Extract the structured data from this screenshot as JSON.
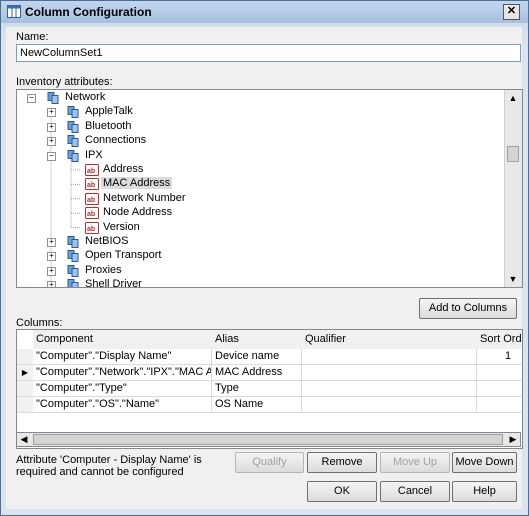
{
  "window": {
    "title": "Column Configuration",
    "close_glyph": "✕"
  },
  "name_field": {
    "label": "Name:",
    "value": "NewColumnSet1"
  },
  "inventory": {
    "label": "Inventory attributes:",
    "nodes": [
      {
        "label": "Network",
        "icon": "network-icon",
        "expander": "−",
        "level": 0
      },
      {
        "label": "AppleTalk",
        "icon": "network-icon",
        "expander": "+",
        "level": 1
      },
      {
        "label": "Bluetooth",
        "icon": "network-icon",
        "expander": "+",
        "level": 1
      },
      {
        "label": "Connections",
        "icon": "network-icon",
        "expander": "+",
        "level": 1
      },
      {
        "label": "IPX",
        "icon": "network-icon",
        "expander": "−",
        "level": 1
      },
      {
        "label": "Address",
        "icon": "attribute-icon",
        "level": 2
      },
      {
        "label": "MAC Address",
        "icon": "attribute-icon",
        "level": 2,
        "selected": true
      },
      {
        "label": "Network Number",
        "icon": "attribute-icon",
        "level": 2
      },
      {
        "label": "Node Address",
        "icon": "attribute-icon",
        "level": 2
      },
      {
        "label": "Version",
        "icon": "attribute-icon",
        "level": 2
      },
      {
        "label": "NetBIOS",
        "icon": "network-icon",
        "expander": "+",
        "level": 1
      },
      {
        "label": "Open Transport",
        "icon": "network-icon",
        "expander": "+",
        "level": 1
      },
      {
        "label": "Proxies",
        "icon": "network-icon",
        "expander": "+",
        "level": 1
      },
      {
        "label": "Shell Driver",
        "icon": "network-icon",
        "expander": "+",
        "level": 1
      }
    ],
    "add_button": "Add to Columns"
  },
  "columns": {
    "label": "Columns:",
    "headers": [
      "Component",
      "Alias",
      "Qualifier",
      "Sort Order"
    ],
    "rows": [
      {
        "component": "\"Computer\".\"Display Name\"",
        "alias": "Device name",
        "qualifier": "",
        "sort": "1",
        "current": false
      },
      {
        "component": "\"Computer\".\"Network\".\"IPX\".\"MAC Ad",
        "alias": "MAC Address",
        "qualifier": "",
        "sort": "",
        "current": true
      },
      {
        "component": "\"Computer\".\"Type\"",
        "alias": "Type",
        "qualifier": "",
        "sort": "",
        "current": false
      },
      {
        "component": "\"Computer\".\"OS\".\"Name\"",
        "alias": "OS Name",
        "qualifier": "",
        "sort": "",
        "current": false
      }
    ]
  },
  "note": "Attribute 'Computer - Display Name' is required and cannot be configured",
  "buttons": {
    "qualify": "Qualify",
    "remove": "Remove",
    "move_up": "Move Up",
    "move_down": "Move Down",
    "ok": "OK",
    "cancel": "Cancel",
    "help": "Help"
  },
  "colors": {
    "selection": "#dcdcdc",
    "title_gradient": "#a7c0df"
  }
}
